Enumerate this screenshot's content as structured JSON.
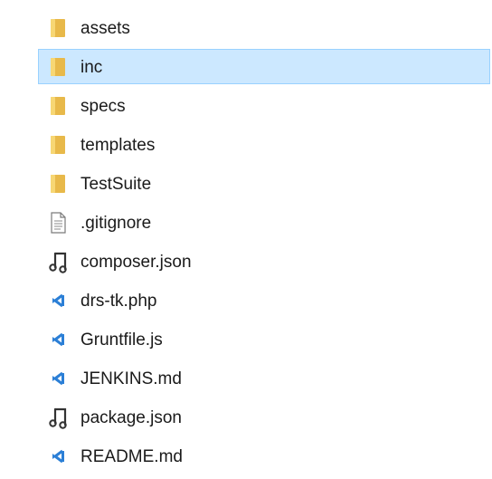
{
  "explorer": {
    "items": [
      {
        "name": "assets",
        "type": "folder",
        "icon": "folder-icon",
        "selected": false
      },
      {
        "name": "inc",
        "type": "folder",
        "icon": "folder-icon",
        "selected": true
      },
      {
        "name": "specs",
        "type": "folder",
        "icon": "folder-icon",
        "selected": false
      },
      {
        "name": "templates",
        "type": "folder",
        "icon": "folder-icon",
        "selected": false
      },
      {
        "name": "TestSuite",
        "type": "folder",
        "icon": "folder-icon",
        "selected": false
      },
      {
        "name": ".gitignore",
        "type": "text-file",
        "icon": "text-file-icon",
        "selected": false
      },
      {
        "name": "composer.json",
        "type": "json-file",
        "icon": "json-file-icon",
        "selected": false
      },
      {
        "name": "drs-tk.php",
        "type": "vscode-file",
        "icon": "vscode-file-icon",
        "selected": false
      },
      {
        "name": "Gruntfile.js",
        "type": "vscode-file",
        "icon": "vscode-file-icon",
        "selected": false
      },
      {
        "name": "JENKINS.md",
        "type": "vscode-file",
        "icon": "vscode-file-icon",
        "selected": false
      },
      {
        "name": "package.json",
        "type": "json-file",
        "icon": "json-file-icon",
        "selected": false
      },
      {
        "name": "README.md",
        "type": "vscode-file",
        "icon": "vscode-file-icon",
        "selected": false
      }
    ]
  },
  "colors": {
    "folder": "#e8b94a",
    "folder_light": "#f7d774",
    "selection_bg": "#cce8ff",
    "selection_border": "#99d1ff",
    "vscode_blue": "#2b7fd6"
  }
}
